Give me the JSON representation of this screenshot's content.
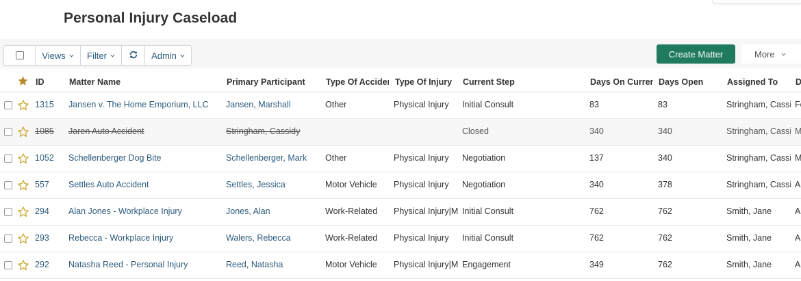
{
  "page": {
    "title": "Personal Injury Caseload"
  },
  "toolbar": {
    "views_label": "Views",
    "filter_label": "Filter",
    "admin_label": "Admin",
    "create_label": "Create Matter",
    "more_label": "More"
  },
  "colors": {
    "accent_link": "#2d5b7c",
    "create_button": "#1f7a5f",
    "star": "#c9a227"
  },
  "icons": {
    "refresh": "refresh-icon",
    "star": "star-icon",
    "chevron": "chevron-down-icon"
  },
  "table": {
    "columns": {
      "id": "ID",
      "matter_name": "Matter Name",
      "primary_participant": "Primary Participant",
      "type_of_accident": "Type Of Accident",
      "type_of_injury": "Type Of Injury",
      "current_step": "Current Step",
      "days_on_current": "Days On Current Step",
      "days_open": "Days Open",
      "assigned_to": "Assigned To",
      "last": "D"
    },
    "rows": [
      {
        "id": "1315",
        "matter_name": "Jansen v. The Home Emporium, LLC",
        "primary_participant": "Jansen, Marshall",
        "type_of_accident": "Other",
        "type_of_injury": "Physical Injury",
        "current_step": "Initial Consult",
        "days_on_current": "83",
        "days_open": "83",
        "assigned_to": "Stringham, Cassidy",
        "last": "Fe",
        "closed": false
      },
      {
        "id": "1085",
        "matter_name": "Jaren Auto Accident",
        "primary_participant": "Stringham, Cassidy",
        "type_of_accident": "",
        "type_of_injury": "",
        "current_step": "Closed",
        "days_on_current": "340",
        "days_open": "340",
        "assigned_to": "Stringham, Cassidy",
        "last": "M",
        "closed": true
      },
      {
        "id": "1052",
        "matter_name": "Schellenberger Dog Bite",
        "primary_participant": "Schellenberger, Mark",
        "type_of_accident": "Other",
        "type_of_injury": "Physical Injury",
        "current_step": "Negotiation",
        "days_on_current": "137",
        "days_open": "340",
        "assigned_to": "Stringham, Cassidy",
        "last": "M",
        "closed": false
      },
      {
        "id": "557",
        "matter_name": "Settles Auto Accident",
        "primary_participant": "Settles, Jessica",
        "type_of_accident": "Motor Vehicle",
        "type_of_injury": "Physical Injury",
        "current_step": "Negotiation",
        "days_on_current": "340",
        "days_open": "378",
        "assigned_to": "Stringham, Cassidy",
        "last": "A",
        "closed": false
      },
      {
        "id": "294",
        "matter_name": "Alan Jones - Workplace Injury",
        "primary_participant": "Jones, Alan",
        "type_of_accident": "Work-Related",
        "type_of_injury": "Physical Injury|M",
        "current_step": "Initial Consult",
        "days_on_current": "762",
        "days_open": "762",
        "assigned_to": "Smith, Jane",
        "last": "A",
        "closed": false
      },
      {
        "id": "293",
        "matter_name": "Rebecca - Workplace Injury",
        "primary_participant": "Walers, Rebecca",
        "type_of_accident": "Work-Related",
        "type_of_injury": "Physical Injury",
        "current_step": "Initial Consult",
        "days_on_current": "762",
        "days_open": "762",
        "assigned_to": "Smith, Jane",
        "last": "A",
        "closed": false
      },
      {
        "id": "292",
        "matter_name": "Natasha Reed - Personal Injury",
        "primary_participant": "Reed, Natasha",
        "type_of_accident": "Motor Vehicle",
        "type_of_injury": "Physical Injury|M",
        "current_step": "Engagement",
        "days_on_current": "349",
        "days_open": "762",
        "assigned_to": "Smith, Jane",
        "last": "A",
        "closed": false
      }
    ]
  }
}
